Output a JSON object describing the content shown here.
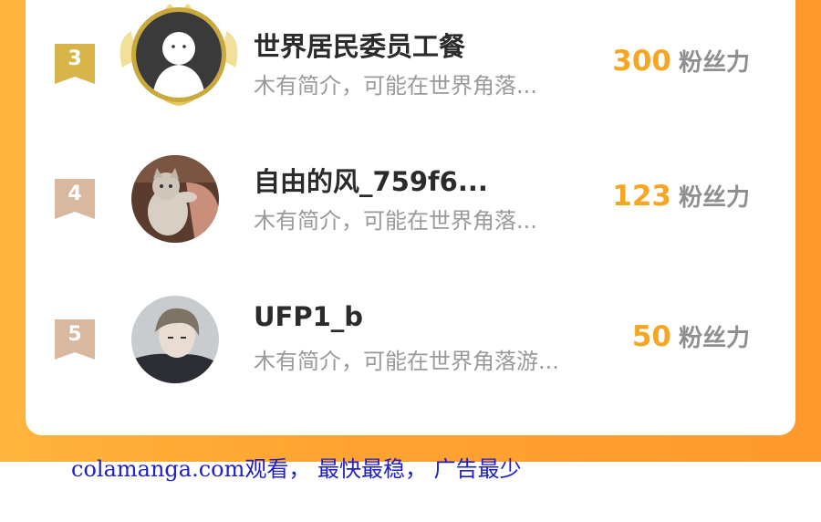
{
  "ranking": {
    "entries": [
      {
        "rank": "3",
        "name": "世界居民委员工餐",
        "description": "木有简介，可能在世界角落...",
        "fans_value": "300",
        "fans_unit": "粉丝力",
        "avatar": "ghost-avatar-with-crown-icon",
        "badge_color": "#d8b54a"
      },
      {
        "rank": "4",
        "name": "自由的风_759f6...",
        "description": "木有简介，可能在世界角落...",
        "fans_value": "123",
        "fans_unit": "粉丝力",
        "avatar": "kitten-photo",
        "badge_color": "#d9b8a0"
      },
      {
        "rank": "5",
        "name": "UFP1_b",
        "description": "木有简介，可能在世界角落游...",
        "fans_value": "50",
        "fans_unit": "粉丝力",
        "avatar": "anime-character",
        "badge_color": "#d9b8a0"
      }
    ]
  },
  "footer": {
    "watermark": "colamanga.com观看， 最快最稳， 广告最少"
  },
  "colors": {
    "accent_orange": "#ffa331",
    "fans_number": "#f5a623",
    "name_text": "#2b2b2b",
    "desc_text": "#9a9a9a",
    "footer_text": "#2020c8"
  }
}
